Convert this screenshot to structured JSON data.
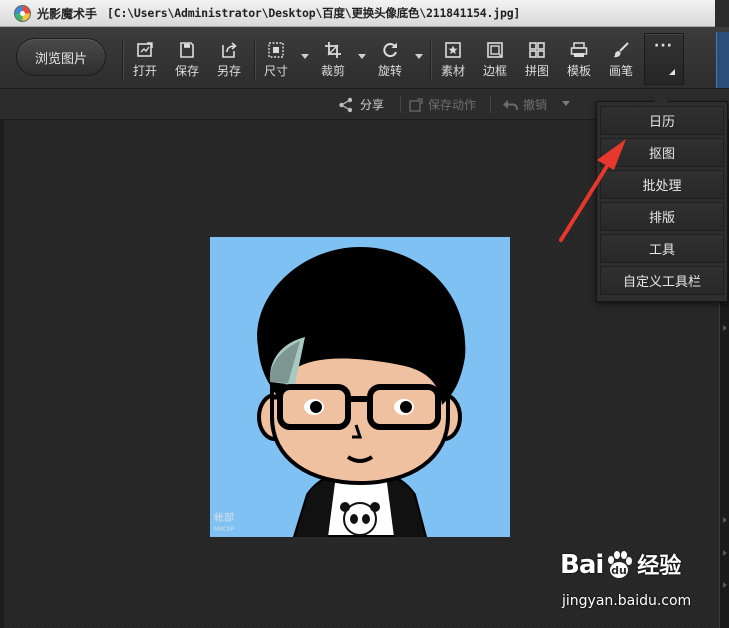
{
  "window": {
    "app_name": "光影魔术手",
    "path": "[C:\\Users\\Administrator\\Desktop\\百度\\更换头像底色\\211841154.jpg]"
  },
  "toolbar": {
    "browse_label": "浏览图片",
    "tools": [
      {
        "label": "打开",
        "icon": "open-icon"
      },
      {
        "label": "保存",
        "icon": "save-icon"
      },
      {
        "label": "另存",
        "icon": "save-as-icon"
      },
      {
        "label": "尺寸",
        "icon": "resize-icon"
      },
      {
        "label": "裁剪",
        "icon": "crop-icon"
      },
      {
        "label": "旋转",
        "icon": "rotate-icon"
      },
      {
        "label": "素材",
        "icon": "material-icon"
      },
      {
        "label": "边框",
        "icon": "border-icon"
      },
      {
        "label": "拼图",
        "icon": "collage-icon"
      },
      {
        "label": "模板",
        "icon": "template-icon"
      },
      {
        "label": "画笔",
        "icon": "brush-icon"
      }
    ],
    "more_label": "···"
  },
  "subbar": {
    "share": "分享",
    "save_action": "保存动作",
    "undo": "撤销"
  },
  "menu": {
    "items": [
      "日历",
      "抠图",
      "批处理",
      "排版",
      "工具",
      "自定义工具栏"
    ]
  },
  "photo": {
    "signature": "帐部",
    "signature_sub": "MYCYP"
  },
  "watermark": {
    "bai": "Bai",
    "du": "du",
    "cn": "经验",
    "url": "jingyan.baidu.com"
  },
  "colors": {
    "photo_bg": "#7ec1f2",
    "arrow": "#e8372d",
    "skin": "#f0c1a1"
  }
}
